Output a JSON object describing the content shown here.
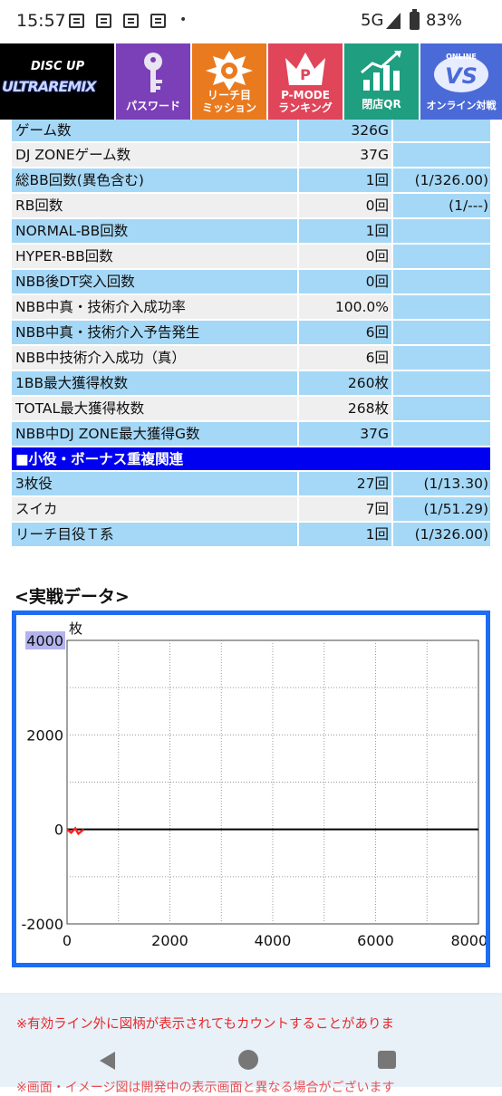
{
  "status_bar": {
    "time": "15:57",
    "network": "5G",
    "battery": "83%"
  },
  "menu": {
    "logo_top": "DISC UP",
    "logo_main": "ULTRAREMIX",
    "items": [
      {
        "label": "パスワード",
        "icon": "key-icon"
      },
      {
        "label": "リーチ目\nミッション",
        "icon": "reach-mission-icon"
      },
      {
        "label": "P-MODE\nランキング",
        "icon": "p-mode-icon"
      },
      {
        "label": "閉店QR",
        "icon": "qr-chart-icon"
      },
      {
        "label": "オンライン対戦",
        "icon": "vs-icon"
      }
    ]
  },
  "stats": [
    {
      "name": "ゲーム数",
      "value": "326G",
      "prob": "",
      "style": "blue"
    },
    {
      "name": "DJ ZONEゲーム数",
      "value": "37G",
      "prob": "",
      "style": "gray"
    },
    {
      "name": "総BB回数(異色含む)",
      "value": "1回",
      "prob": "(1/326.00)",
      "style": "blue"
    },
    {
      "name": "RB回数",
      "value": "0回",
      "prob": "(1/---)",
      "style": "gray"
    },
    {
      "name": "NORMAL-BB回数",
      "value": "1回",
      "prob": "",
      "style": "blue"
    },
    {
      "name": "HYPER-BB回数",
      "value": "0回",
      "prob": "",
      "style": "gray"
    },
    {
      "name": "NBB後DT突入回数",
      "value": "0回",
      "prob": "",
      "style": "blue"
    },
    {
      "name": "NBB中真・技術介入成功率",
      "value": "100.0%",
      "prob": "",
      "style": "gray"
    },
    {
      "name": "NBB中真・技術介入予告発生",
      "value": "6回",
      "prob": "",
      "style": "blue"
    },
    {
      "name": "NBB中技術介入成功（真）",
      "value": "6回",
      "prob": "",
      "style": "gray"
    },
    {
      "name": "1BB最大獲得枚数",
      "value": "260枚",
      "prob": "",
      "style": "blue"
    },
    {
      "name": "TOTAL最大獲得枚数",
      "value": "268枚",
      "prob": "",
      "style": "gray"
    },
    {
      "name": "NBB中DJ ZONE最大獲得G数",
      "value": "37G",
      "prob": "",
      "style": "blue"
    }
  ],
  "section_header": "■小役・ボーナス重複関連",
  "koyaku": [
    {
      "name": "3枚役",
      "value": "27回",
      "prob": "(1/13.30)",
      "style": "blue"
    },
    {
      "name": "スイカ",
      "value": "7回",
      "prob": "(1/51.29)",
      "style": "gray"
    },
    {
      "name": "リーチ目役Ｔ系",
      "value": "1回",
      "prob": "(1/326.00)",
      "style": "blue"
    }
  ],
  "section_title": "<実戦データ>",
  "chart_data": {
    "type": "line",
    "ylabel": "枚",
    "y_ticks": [
      "4000",
      "2000",
      "0",
      "-2000"
    ],
    "x_ticks": [
      "0",
      "2000",
      "4000",
      "6000",
      "8000G"
    ],
    "xlim": [
      0,
      8000
    ],
    "ylim": [
      -2000,
      4000
    ],
    "grid": true,
    "series": [
      {
        "color": "#ff2222",
        "points": [
          [
            0,
            0
          ],
          [
            80,
            -70
          ],
          [
            160,
            20
          ],
          [
            220,
            -90
          ],
          [
            326,
            0
          ]
        ]
      }
    ]
  },
  "notice": "※有効ライン外に図柄が表示されてもカウントすることがありま",
  "notice2": "※画面・イメージ図は開発中の表示画面と異なる場合がございます"
}
